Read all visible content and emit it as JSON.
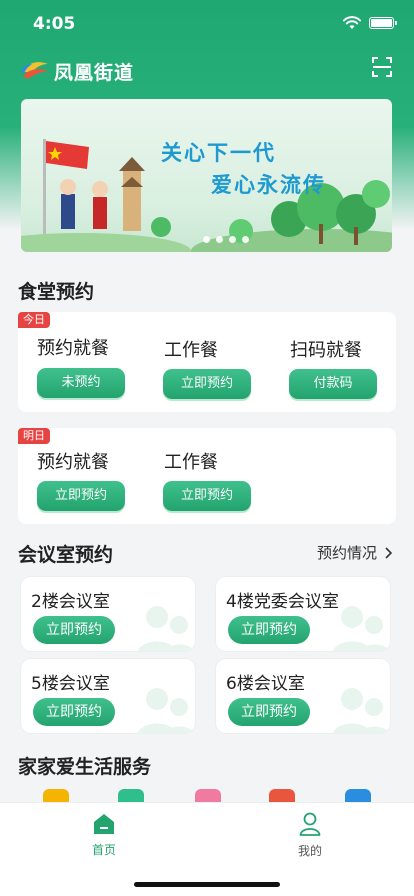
{
  "status_bar": {
    "time": "4:05",
    "icons": [
      "wifi-icon",
      "battery-icon"
    ]
  },
  "header": {
    "title": "凤凰街道",
    "logo_icon": "phoenix-logo-icon",
    "scan_icon": "scan-icon"
  },
  "banner": {
    "line1": "关心下一代",
    "line2": "爱心永流传",
    "page_count": 4
  },
  "canteen": {
    "title": "食堂预约",
    "today": {
      "tag": "今日",
      "items": [
        {
          "label": "预约就餐",
          "button": "未预约"
        },
        {
          "label": "工作餐",
          "button": "立即预约"
        },
        {
          "label": "扫码就餐",
          "button": "付款码"
        }
      ]
    },
    "tomorrow": {
      "tag": "明日",
      "items": [
        {
          "label": "预约就餐",
          "button": "立即预约"
        },
        {
          "label": "工作餐",
          "button": "立即预约"
        }
      ]
    }
  },
  "meeting": {
    "title": "会议室预约",
    "more_link": "预约情况",
    "rooms": [
      {
        "name": "2楼会议室",
        "button": "立即预约"
      },
      {
        "name": "4楼党委会议室",
        "button": "立即预约"
      },
      {
        "name": "5楼会议室",
        "button": "立即预约"
      },
      {
        "name": "6楼会议室",
        "button": "立即预约"
      }
    ]
  },
  "services": {
    "title": "家家爱生活服务",
    "icon_colors": [
      "#f5b400",
      "#2fbf8c",
      "#f07aa0",
      "#e8563d",
      "#2a8de0"
    ]
  },
  "tabbar": {
    "tabs": [
      {
        "label": "首页",
        "icon": "home-icon",
        "active": true
      },
      {
        "label": "我的",
        "icon": "profile-icon",
        "active": false
      }
    ],
    "active_color": "#23a46f"
  },
  "colors": {
    "brand_green": "#23a46f",
    "tag_red": "#e64343",
    "banner_text": "#1e9ad0"
  }
}
